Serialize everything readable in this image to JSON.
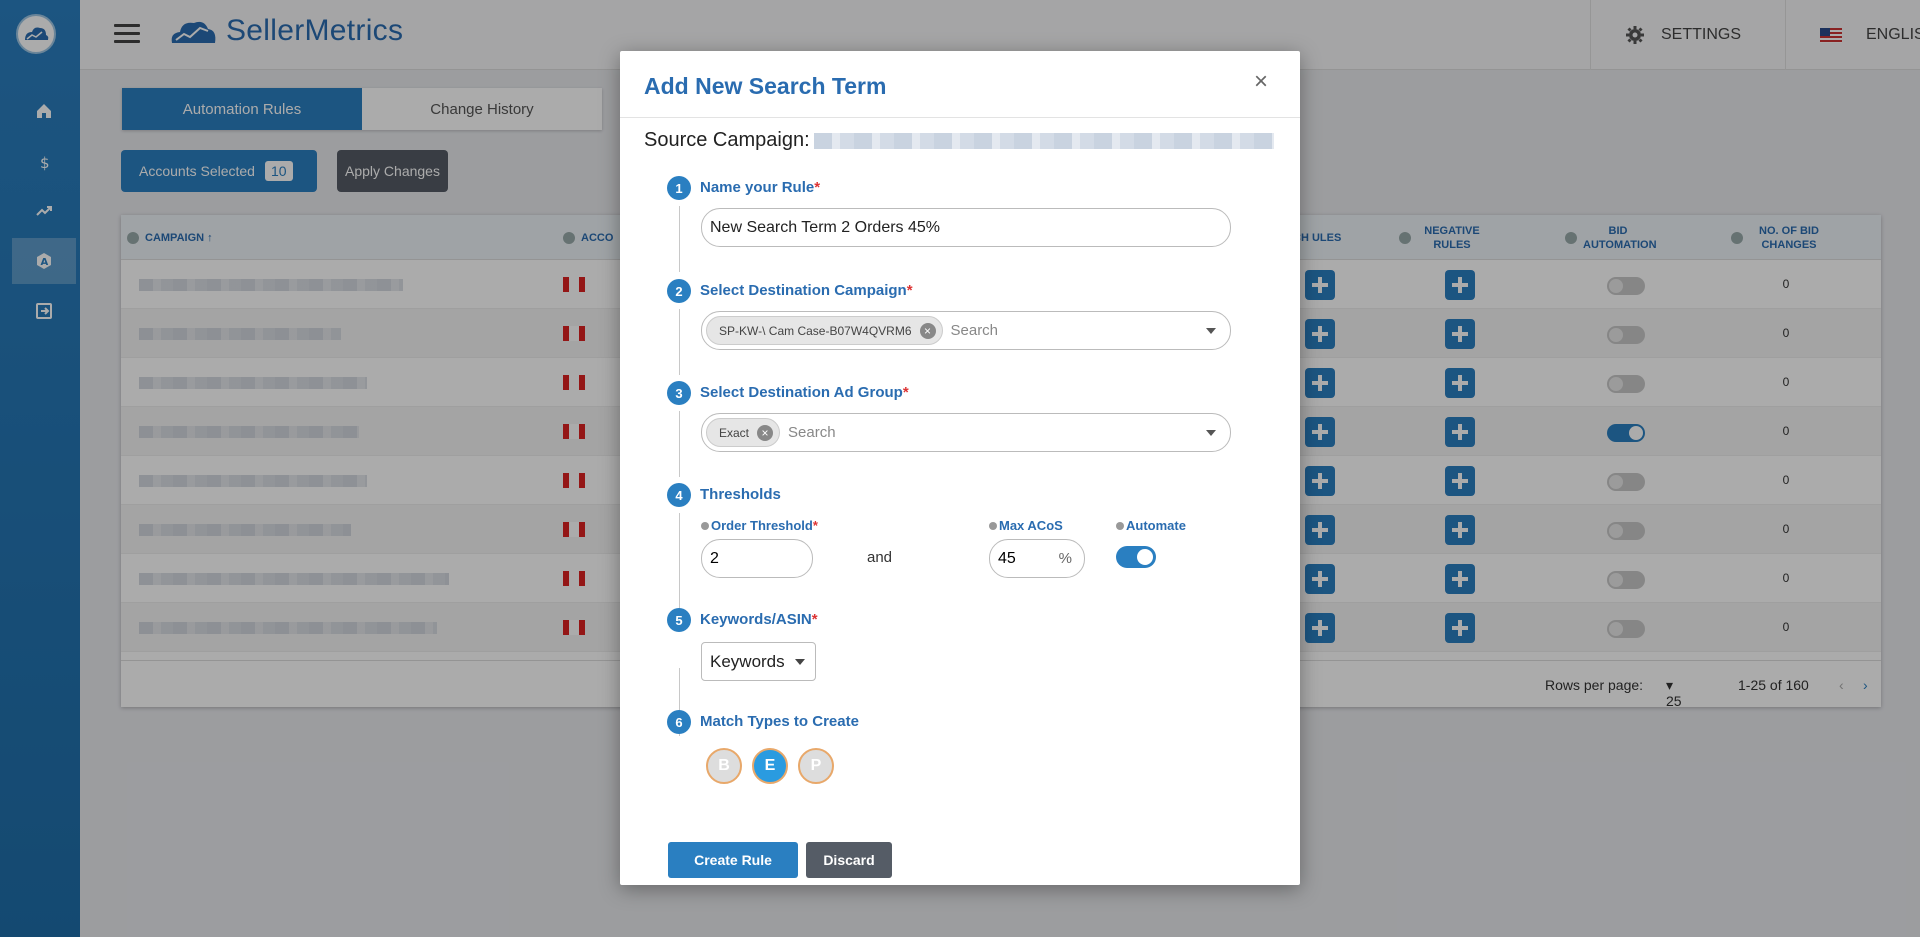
{
  "app": {
    "brand": "SellerMetrics",
    "settings_label": "SETTINGS",
    "language_label": "ENGLISH"
  },
  "sidebar": {
    "items": [
      {
        "icon": "home-icon"
      },
      {
        "icon": "dollar-icon"
      },
      {
        "icon": "trend-icon"
      },
      {
        "icon": "automation-icon",
        "active": true
      },
      {
        "icon": "logout-icon"
      }
    ]
  },
  "page": {
    "tabs": [
      {
        "label": "Automation Rules",
        "active": true
      },
      {
        "label": "Change History",
        "active": false
      }
    ],
    "accounts_selected_label": "Accounts Selected",
    "accounts_selected_count": "10",
    "apply_changes_label": "Apply Changes",
    "table": {
      "columns": [
        "CAMPAIGN",
        "ACCO",
        "CH ULES",
        "NEGATIVE RULES",
        "BID AUTOMATION",
        "NO. OF BID CHANGES"
      ],
      "rows": [
        {
          "bid_automation": false,
          "bid_changes": "0"
        },
        {
          "bid_automation": false,
          "bid_changes": "0"
        },
        {
          "bid_automation": false,
          "bid_changes": "0"
        },
        {
          "bid_automation": true,
          "bid_changes": "0"
        },
        {
          "bid_automation": false,
          "bid_changes": "0"
        },
        {
          "bid_automation": false,
          "bid_changes": "0"
        },
        {
          "bid_automation": false,
          "bid_changes": "0"
        },
        {
          "bid_automation": false,
          "bid_changes": "0"
        }
      ],
      "rows_per_page_label": "Rows per page:",
      "rows_per_page_value": "25",
      "pagination_text": "1-25 of 160"
    }
  },
  "modal": {
    "title": "Add New Search Term",
    "source_campaign_label": "Source Campaign:",
    "steps": [
      {
        "num": "1",
        "label": "Name your Rule",
        "required": true
      },
      {
        "num": "2",
        "label": "Select Destination Campaign",
        "required": true
      },
      {
        "num": "3",
        "label": "Select Destination Ad Group",
        "required": true
      },
      {
        "num": "4",
        "label": "Thresholds",
        "required": false
      },
      {
        "num": "5",
        "label": "Keywords/ASIN",
        "required": true
      },
      {
        "num": "6",
        "label": "Match Types to Create",
        "required": false
      }
    ],
    "rule_name_value": "New Search Term 2 Orders 45%",
    "destination_campaign_chip": "SP-KW-\\ Cam Case-B07W4QVRM6",
    "destination_campaign_placeholder": "Search",
    "ad_group_chip": "Exact",
    "ad_group_placeholder": "Search",
    "thresholds": {
      "order_threshold_label": "Order Threshold",
      "order_threshold_value": "2",
      "and_label": "and",
      "max_acos_label": "Max ACoS",
      "max_acos_value": "45",
      "percent_symbol": "%",
      "automate_label": "Automate",
      "automate_on": true
    },
    "keywords_asin_value": "Keywords",
    "match_types": [
      {
        "letter": "B",
        "selected": false
      },
      {
        "letter": "E",
        "selected": true
      },
      {
        "letter": "P",
        "selected": false
      }
    ],
    "create_label": "Create Rule",
    "discard_label": "Discard",
    "close_symbol": "×"
  },
  "colors": {
    "primary": "#2a7fc1",
    "title_blue": "#2a6cb0",
    "required_red": "#d33",
    "dark_button": "#555c66",
    "match_type_border": "#e8a86a"
  }
}
